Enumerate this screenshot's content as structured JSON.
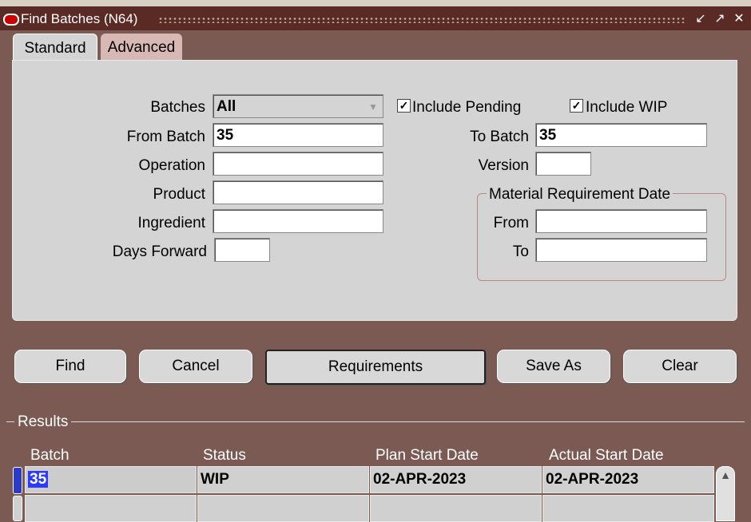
{
  "window": {
    "title": "Find Batches (N64)"
  },
  "tabs": [
    {
      "label": "Standard"
    },
    {
      "label": "Advanced"
    }
  ],
  "form": {
    "batches_label": "Batches",
    "batches_value": "All",
    "include_pending_label": "Include Pending",
    "include_pending_checked": true,
    "include_wip_label": "Include WIP",
    "include_wip_checked": true,
    "from_batch_label": "From Batch",
    "from_batch_value": "35",
    "to_batch_label": "To Batch",
    "to_batch_value": "35",
    "operation_label": "Operation",
    "operation_value": "",
    "version_label": "Version",
    "version_value": "",
    "product_label": "Product",
    "product_value": "",
    "ingredient_label": "Ingredient",
    "ingredient_value": "",
    "days_forward_label": "Days Forward",
    "days_forward_value": "",
    "mrd_label": "Material Requirement Date",
    "mrd_from_label": "From",
    "mrd_from_value": "",
    "mrd_to_label": "To",
    "mrd_to_value": ""
  },
  "buttons": {
    "find": "Find",
    "cancel": "Cancel",
    "requirements": "Requirements",
    "save_as": "Save As",
    "clear": "Clear"
  },
  "results": {
    "label": "Results",
    "columns": [
      "Batch",
      "Status",
      "Plan Start Date",
      "Actual Start Date"
    ],
    "rows": [
      [
        "35",
        "WIP",
        "02-APR-2023",
        "02-APR-2023"
      ],
      [
        "",
        "",
        "",
        ""
      ]
    ]
  },
  "colors": {
    "titlebar": "#5a2a24",
    "background": "#7a5a52",
    "panel": "#d4d4d4",
    "selection": "#2a3aff"
  }
}
